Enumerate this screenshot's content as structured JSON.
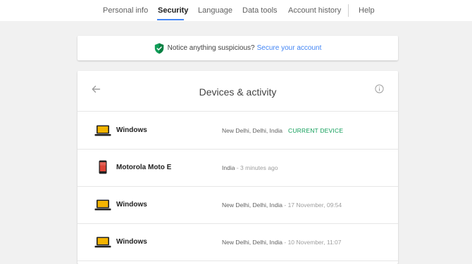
{
  "nav": {
    "items": [
      {
        "label": "Personal info"
      },
      {
        "label": "Security"
      },
      {
        "label": "Language"
      },
      {
        "label": "Data tools"
      },
      {
        "label": "Account history"
      },
      {
        "label": "Help"
      }
    ],
    "active_index": 1,
    "accent_color": "#4285f4"
  },
  "notice": {
    "text": "Notice anything suspicious?",
    "link": "Secure your account",
    "icon": "shield-check-icon",
    "icon_color": "#0f9d58"
  },
  "devices": {
    "title": "Devices & activity",
    "back_icon": "arrow-back-icon",
    "info_icon": "info-icon",
    "list": [
      {
        "name": "Windows",
        "icon": "laptop-icon",
        "location": "New Delhi, Delhi, India",
        "separator": "",
        "time": "",
        "badge": "CURRENT DEVICE"
      },
      {
        "name": "Motorola Moto E",
        "icon": "phone-icon",
        "location": "India",
        "separator": "-",
        "time": "3 minutes ago",
        "badge": ""
      },
      {
        "name": "Windows",
        "icon": "laptop-icon",
        "location": "New Delhi, Delhi, India",
        "separator": "-",
        "time": "17 November, 09:54",
        "badge": ""
      },
      {
        "name": "Windows",
        "icon": "laptop-icon",
        "location": "New Delhi, Delhi, India",
        "separator": "-",
        "time": "10 November, 11:07",
        "badge": ""
      }
    ],
    "badge_color": "#0f9d58"
  }
}
